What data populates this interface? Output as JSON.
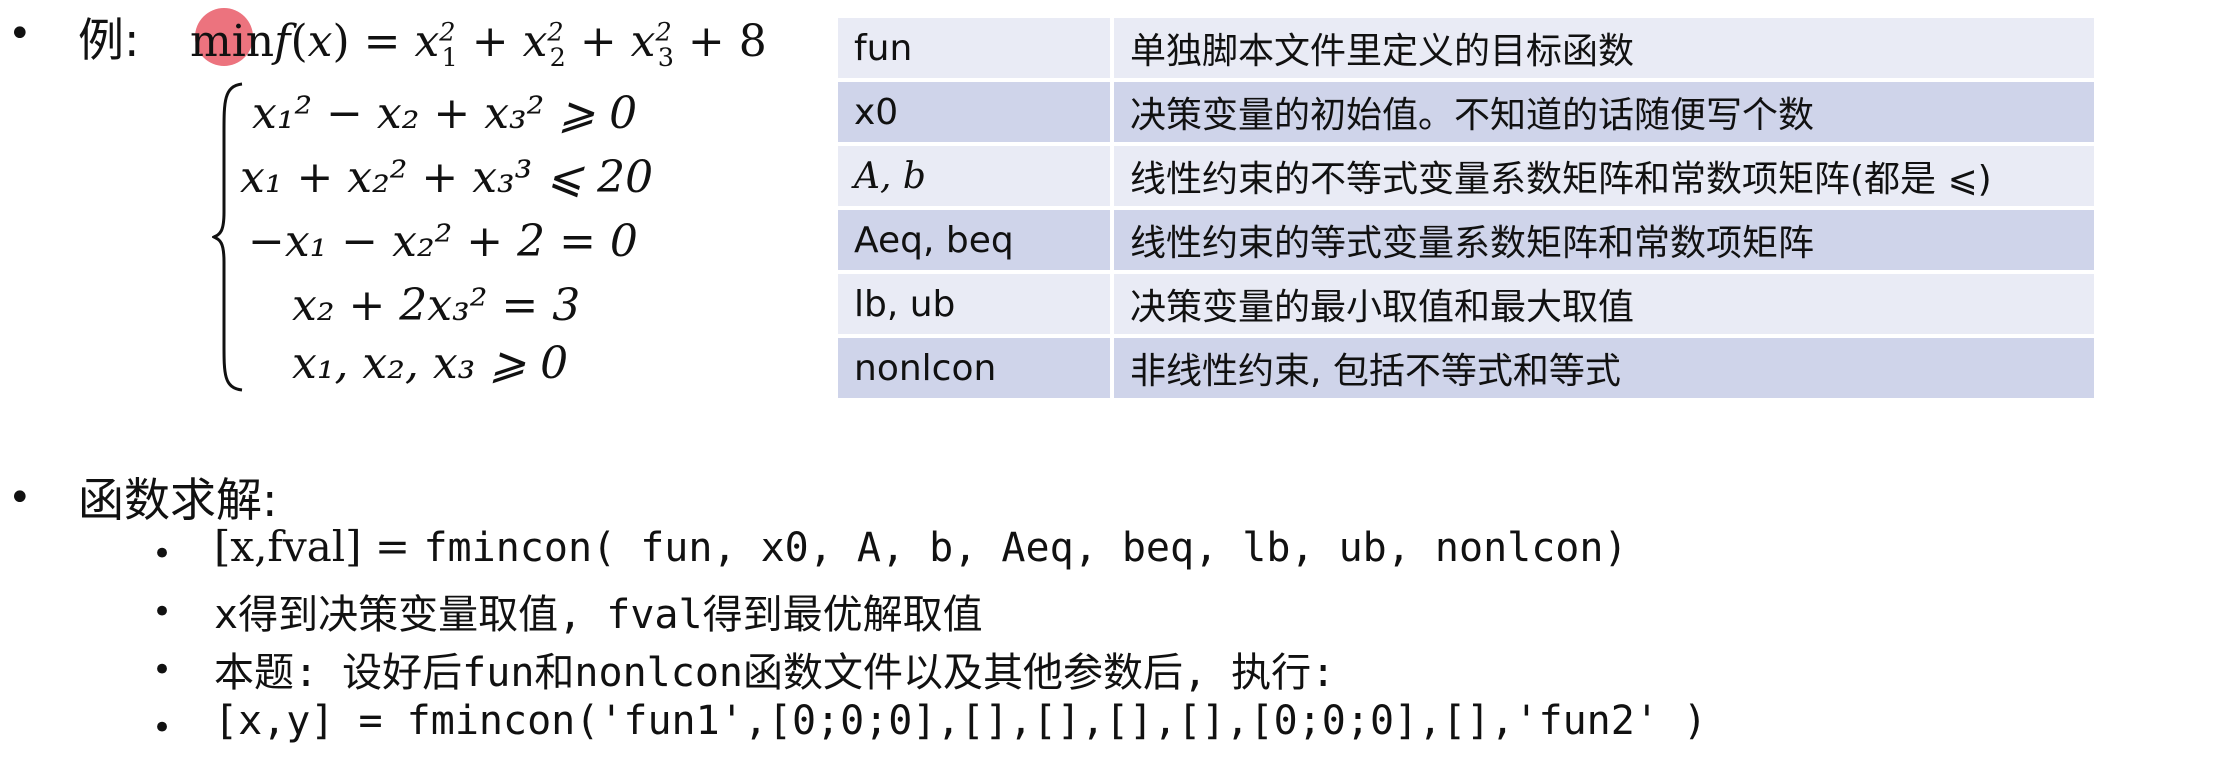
{
  "example": {
    "bullet": "•",
    "label": "例:",
    "objective": {
      "min": "min",
      "f": "f",
      "x": "x",
      "eq": "= ",
      "x1": "x",
      "x1_sub": "1",
      "x1_sup": "2",
      "plus1": " + ",
      "x2": "x",
      "x2_sub": "2",
      "x2_sup": "2",
      "plus2": " + ",
      "x3": "x",
      "x3_sub": "3",
      "x3_sup": "2",
      "tail": " + 8"
    },
    "constraints": [
      "x₁² − x₂ + x₃² ⩾ 0",
      "x₁ + x₂² + x₃³ ⩽ 20",
      "−x₁ − x₂² + 2 = 0",
      "x₂ + 2x₃² = 3",
      "x₁, x₂, x₃ ⩾ 0"
    ]
  },
  "params_table": {
    "rows": [
      {
        "name": "fun",
        "desc": "单独脚本文件里定义的目标函数"
      },
      {
        "name": "x0",
        "desc": "决策变量的初始值。不知道的话随便写个数"
      },
      {
        "name": "A, b",
        "desc": "线性约束的不等式变量系数矩阵和常数项矩阵(都是 ⩽)"
      },
      {
        "name": "Aeq, beq",
        "desc": "线性约束的等式变量系数矩阵和常数项矩阵"
      },
      {
        "name": "lb, ub",
        "desc": "决策变量的最小取值和最大取值"
      },
      {
        "name": "nonlcon",
        "desc": "非线性约束, 包括不等式和等式"
      }
    ]
  },
  "solve": {
    "bullet": "•",
    "label": "函数求解:",
    "items": [
      {
        "bullet": "•",
        "prefix": "[x,fval] = ",
        "text": "fmincon( fun, x0, A, b, Aeq, beq, lb, ub, nonlcon)"
      },
      {
        "bullet": "•",
        "text": "x得到决策变量取值, fval得到最优解取值"
      },
      {
        "bullet": "•",
        "text": "本题: 设好后fun和nonlcon函数文件以及其他参数后, 执行:"
      },
      {
        "bullet": "•",
        "text": "[x,y] = fmincon('fun1',[0;0;0],[],[],[],[],[0;0;0],[],'fun2' )"
      }
    ]
  }
}
